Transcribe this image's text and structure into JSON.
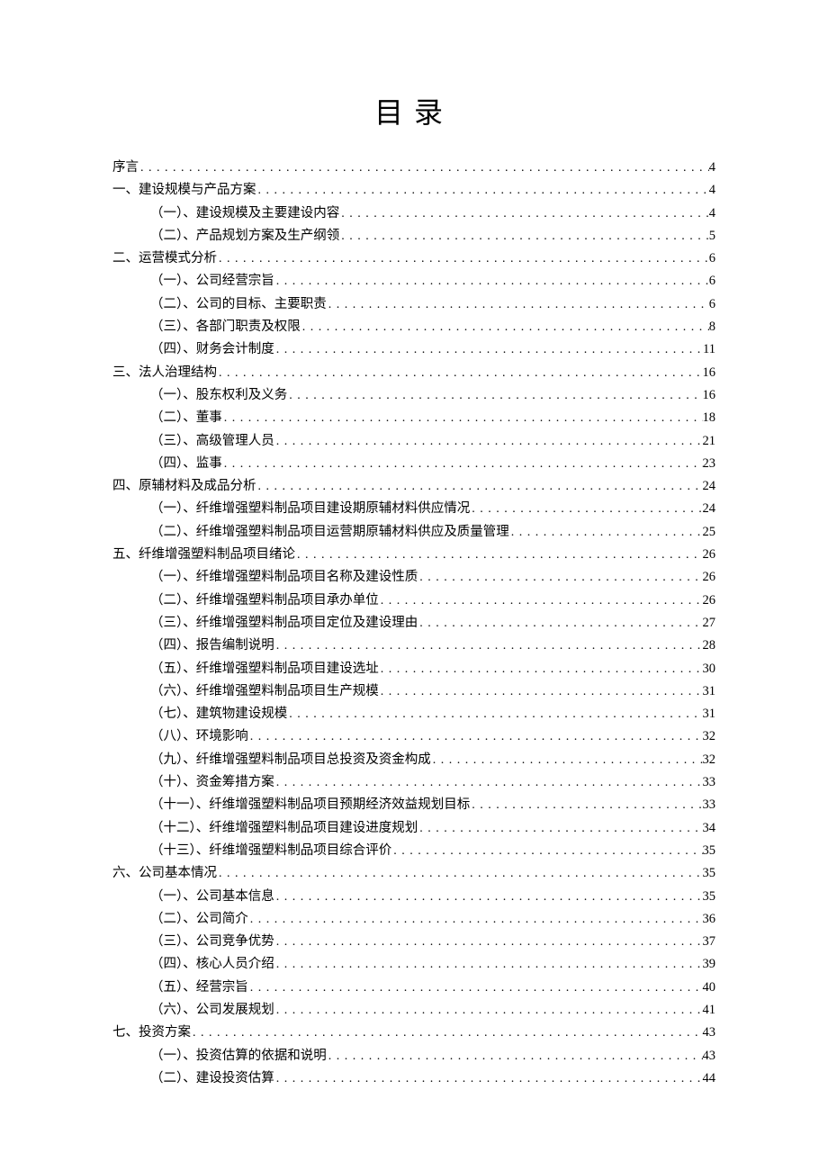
{
  "title": "目录",
  "toc": [
    {
      "level": 0,
      "label": "序言",
      "page": "4"
    },
    {
      "level": 0,
      "label": "一、建设规模与产品方案",
      "page": "4"
    },
    {
      "level": 1,
      "label": "（一）、建设规模及主要建设内容",
      "page": "4"
    },
    {
      "level": 1,
      "label": "（二）、产品规划方案及生产纲领",
      "page": "5"
    },
    {
      "level": 0,
      "label": "二、运营模式分析",
      "page": "6"
    },
    {
      "level": 1,
      "label": "（一）、公司经营宗旨",
      "page": "6"
    },
    {
      "level": 1,
      "label": "（二）、公司的目标、主要职责",
      "page": "6"
    },
    {
      "level": 1,
      "label": "（三）、各部门职责及权限",
      "page": "8"
    },
    {
      "level": 1,
      "label": "（四）、财务会计制度",
      "page": "11"
    },
    {
      "level": 0,
      "label": "三、法人治理结构",
      "page": "16"
    },
    {
      "level": 1,
      "label": "（一）、股东权利及义务",
      "page": "16"
    },
    {
      "level": 1,
      "label": "（二）、董事",
      "page": "18"
    },
    {
      "level": 1,
      "label": "（三）、高级管理人员",
      "page": "21"
    },
    {
      "level": 1,
      "label": "（四）、监事",
      "page": "23"
    },
    {
      "level": 0,
      "label": "四、原辅材料及成品分析",
      "page": "24"
    },
    {
      "level": 1,
      "label": "（一）、纤维增强塑料制品项目建设期原辅材料供应情况",
      "page": "24"
    },
    {
      "level": 1,
      "label": "（二）、纤维增强塑料制品项目运营期原辅材料供应及质量管理",
      "page": "25"
    },
    {
      "level": 0,
      "label": "五、纤维增强塑料制品项目绪论",
      "page": "26"
    },
    {
      "level": 1,
      "label": "（一）、纤维增强塑料制品项目名称及建设性质",
      "page": "26"
    },
    {
      "level": 1,
      "label": "（二）、纤维增强塑料制品项目承办单位",
      "page": "26"
    },
    {
      "level": 1,
      "label": "（三）、纤维增强塑料制品项目定位及建设理由",
      "page": "27"
    },
    {
      "level": 1,
      "label": "（四）、报告编制说明",
      "page": "28"
    },
    {
      "level": 1,
      "label": "（五）、纤维增强塑料制品项目建设选址",
      "page": "30"
    },
    {
      "level": 1,
      "label": "（六）、纤维增强塑料制品项目生产规模",
      "page": "31"
    },
    {
      "level": 1,
      "label": "（七）、建筑物建设规模",
      "page": "31"
    },
    {
      "level": 1,
      "label": "（八）、环境影响",
      "page": "32"
    },
    {
      "level": 1,
      "label": "（九）、纤维增强塑料制品项目总投资及资金构成",
      "page": "32"
    },
    {
      "level": 1,
      "label": "（十）、资金筹措方案",
      "page": "33"
    },
    {
      "level": 1,
      "label": "（十一）、纤维增强塑料制品项目预期经济效益规划目标",
      "page": "33"
    },
    {
      "level": 1,
      "label": "（十二）、纤维增强塑料制品项目建设进度规划",
      "page": "34"
    },
    {
      "level": 1,
      "label": "（十三）、纤维增强塑料制品项目综合评价",
      "page": "35"
    },
    {
      "level": 0,
      "label": "六、公司基本情况",
      "page": "35"
    },
    {
      "level": 1,
      "label": "（一）、公司基本信息",
      "page": "35"
    },
    {
      "level": 1,
      "label": "（二）、公司简介",
      "page": "36"
    },
    {
      "level": 1,
      "label": "（三）、公司竞争优势",
      "page": "37"
    },
    {
      "level": 1,
      "label": "（四）、核心人员介绍",
      "page": "39"
    },
    {
      "level": 1,
      "label": "（五）、经营宗旨",
      "page": "40"
    },
    {
      "level": 1,
      "label": "（六）、公司发展规划",
      "page": "41"
    },
    {
      "level": 0,
      "label": "七、投资方案",
      "page": "43"
    },
    {
      "level": 1,
      "label": "（一）、投资估算的依据和说明",
      "page": "43"
    },
    {
      "level": 1,
      "label": "（二）、建设投资估算",
      "page": "44"
    }
  ]
}
